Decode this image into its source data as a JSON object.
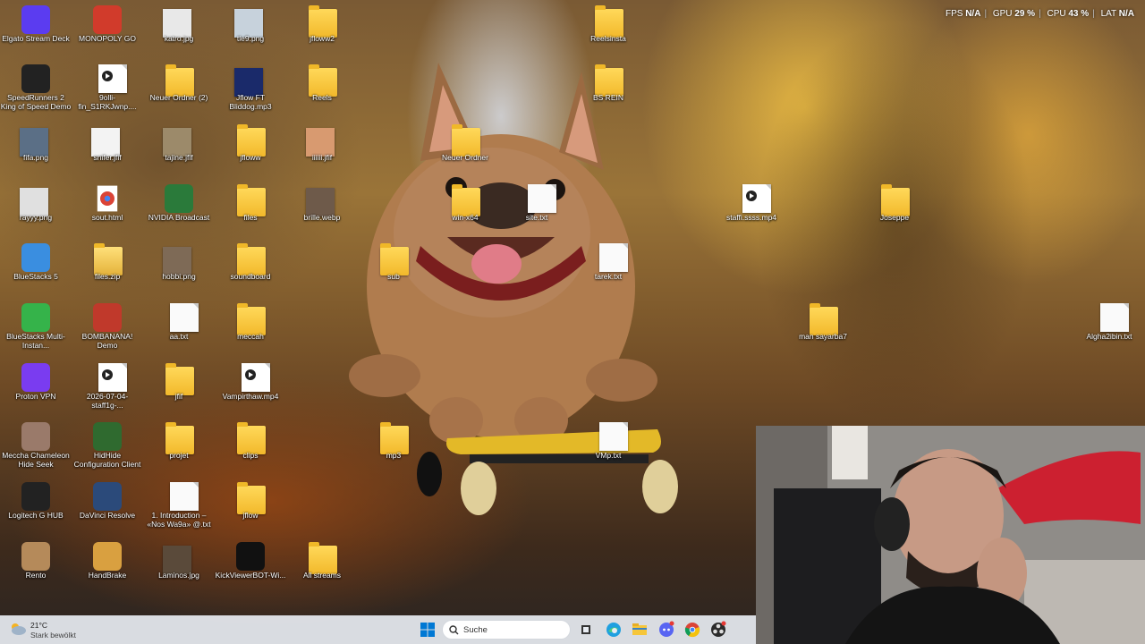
{
  "overlay": {
    "fps_label": "FPS",
    "fps_value": "N/A",
    "gpu_label": "GPU",
    "gpu_value": "29 %",
    "cpu_label": "CPU",
    "cpu_value": "43 %",
    "lat_label": "LAT",
    "lat_value": "N/A"
  },
  "desktop": {
    "icons": [
      {
        "label": "Elgato Stream Deck",
        "type": "app"
      },
      {
        "label": "MONOPOLY GO",
        "type": "app"
      },
      {
        "label": "katro.jpg",
        "type": "image"
      },
      {
        "label": "tle9.png",
        "type": "image"
      },
      {
        "label": "jfloww2",
        "type": "folder"
      },
      {
        "label": "Reelsinsta",
        "type": "folder"
      },
      {
        "label": "SpeedRunners 2 King of Speed Demo",
        "type": "app"
      },
      {
        "label": "9olli-fin_S1RKJwnp....",
        "type": "video"
      },
      {
        "label": "Neuer Ordner (2)",
        "type": "folder"
      },
      {
        "label": "Jflow FT Bliddog.mp3",
        "type": "audio"
      },
      {
        "label": "Reels",
        "type": "folder"
      },
      {
        "label": "BS REIN",
        "type": "folder"
      },
      {
        "label": "fifa.png",
        "type": "image"
      },
      {
        "label": "snifer.jfif",
        "type": "image"
      },
      {
        "label": "tajine.jfif",
        "type": "image"
      },
      {
        "label": "jfloww",
        "type": "folder"
      },
      {
        "label": "iiiiii.jfif",
        "type": "image"
      },
      {
        "label": "Neuer Ordner",
        "type": "folder"
      },
      {
        "label": "rayyy.png",
        "type": "image"
      },
      {
        "label": "sout.html",
        "type": "chrome"
      },
      {
        "label": "NVIDIA Broadcast",
        "type": "app"
      },
      {
        "label": "files",
        "type": "folder"
      },
      {
        "label": "brille.webp",
        "type": "image"
      },
      {
        "label": "win-x64",
        "type": "folder"
      },
      {
        "label": "site.txt",
        "type": "text"
      },
      {
        "label": "staffi.ssss.mp4",
        "type": "video"
      },
      {
        "label": "Joseppe",
        "type": "folder"
      },
      {
        "label": "BlueStacks 5",
        "type": "app"
      },
      {
        "label": "files.zip",
        "type": "zip"
      },
      {
        "label": "hobbi.png",
        "type": "image"
      },
      {
        "label": "soundboard",
        "type": "folder"
      },
      {
        "label": "sub",
        "type": "folder"
      },
      {
        "label": "tarek.txt",
        "type": "text"
      },
      {
        "label": "BlueStacks Multi-Instan...",
        "type": "app"
      },
      {
        "label": "BOMBANANA! Demo",
        "type": "app"
      },
      {
        "label": "aa.txt",
        "type": "text"
      },
      {
        "label": "meccah",
        "type": "folder"
      },
      {
        "label": "man sayarba7",
        "type": "folder"
      },
      {
        "label": "Algha2ibin.txt",
        "type": "text"
      },
      {
        "label": "Proton VPN",
        "type": "app"
      },
      {
        "label": "2026-07-04-staff1g-...",
        "type": "video"
      },
      {
        "label": "jfif",
        "type": "folder"
      },
      {
        "label": "Vampirthaw.mp4",
        "type": "video"
      },
      {
        "label": "Meccha Chameleon Hide Seek",
        "type": "app"
      },
      {
        "label": "HidHide Configuration Client",
        "type": "app"
      },
      {
        "label": "projet",
        "type": "folder"
      },
      {
        "label": "clips",
        "type": "folder"
      },
      {
        "label": "mp3",
        "type": "folder"
      },
      {
        "label": "VMp.txt",
        "type": "text"
      },
      {
        "label": "Logitech G HUB",
        "type": "app"
      },
      {
        "label": "DaVinci Resolve",
        "type": "app"
      },
      {
        "label": "1. Introduction – «Nos Wa9a» @.txt",
        "type": "text"
      },
      {
        "label": "jflow",
        "type": "folder"
      },
      {
        "label": "Rento",
        "type": "app"
      },
      {
        "label": "HandBrake",
        "type": "app"
      },
      {
        "label": "Laminos.jpg",
        "type": "image"
      },
      {
        "label": "KickViewerBOT-Wi...",
        "type": "app"
      },
      {
        "label": "All streams",
        "type": "folder"
      }
    ]
  },
  "taskbar": {
    "weather_temp": "21°C",
    "weather_condition": "Stark bewölkt",
    "search_placeholder": "Suche",
    "pinned": [
      "windows-start-icon",
      "task-view-icon",
      "edge-icon",
      "file-explorer-icon",
      "discord-icon",
      "chrome-icon",
      "obs-icon"
    ]
  },
  "colors": {
    "folder": "#f6c63a",
    "taskbar": "#e8ecf2",
    "accent": "#0067c0"
  }
}
